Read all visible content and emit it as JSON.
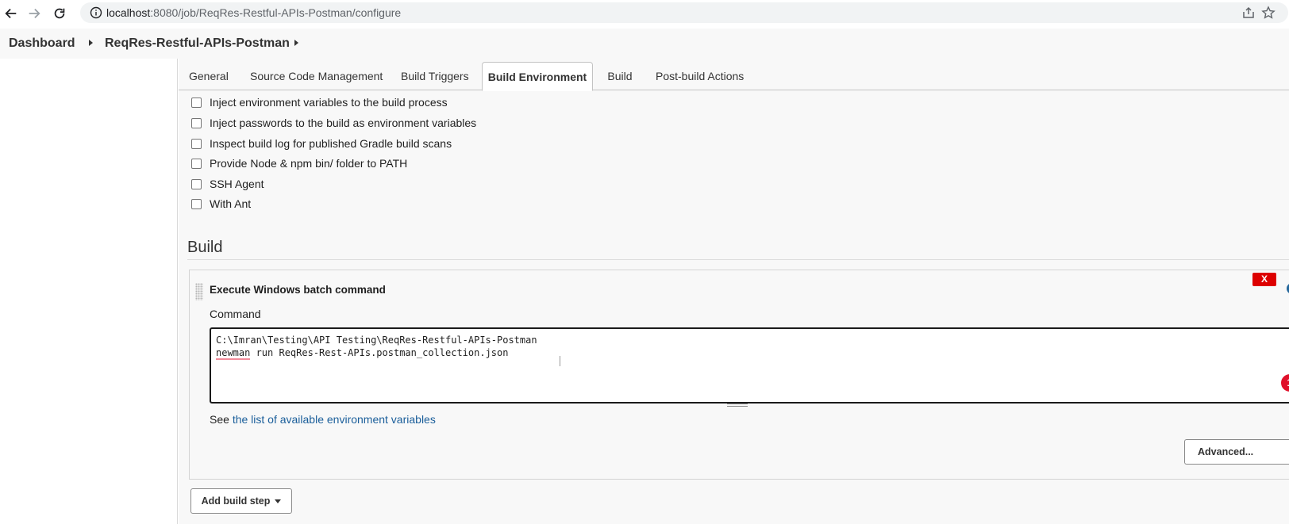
{
  "browser": {
    "url_host": "localhost",
    "url_path": ":8080/job/ReqRes-Restful-APIs-Postman/configure"
  },
  "breadcrumb": {
    "items": [
      {
        "label": "Dashboard"
      },
      {
        "label": "ReqRes-Restful-APIs-Postman"
      }
    ]
  },
  "tabs": [
    {
      "label": "General"
    },
    {
      "label": "Source Code Management"
    },
    {
      "label": "Build Triggers"
    },
    {
      "label": "Build Environment",
      "active": true
    },
    {
      "label": "Build"
    },
    {
      "label": "Post-build Actions"
    }
  ],
  "build_environment": {
    "options": [
      {
        "label": "Inject environment variables to the build process",
        "checked": false
      },
      {
        "label": "Inject passwords to the build as environment variables",
        "checked": false
      },
      {
        "label": "Inspect build log for published Gradle build scans",
        "checked": false
      },
      {
        "label": "Provide Node & npm bin/ folder to PATH",
        "checked": false
      },
      {
        "label": "SSH Agent",
        "checked": false
      },
      {
        "label": "With Ant",
        "checked": false
      }
    ]
  },
  "build": {
    "section_title": "Build",
    "step": {
      "title": "Execute Windows batch command",
      "delete_label": "X",
      "command_label": "Command",
      "command_line1": "C:\\Imran\\Testing\\API Testing\\ReqRes-Restful-APIs-Postman",
      "command_line2_word1": "newman",
      "command_line2_rest": " run ReqRes-Rest-APIs.postman_collection.json",
      "error_count": "1",
      "help_prefix": "See ",
      "help_link": "the list of available environment variables",
      "advanced_label": "Advanced..."
    },
    "add_step_label": "Add build step"
  },
  "colors": {
    "accent_link": "#1a5e9a",
    "delete_red": "#dd0000",
    "error_red": "#e0112b",
    "help_blue": "#23669b"
  }
}
